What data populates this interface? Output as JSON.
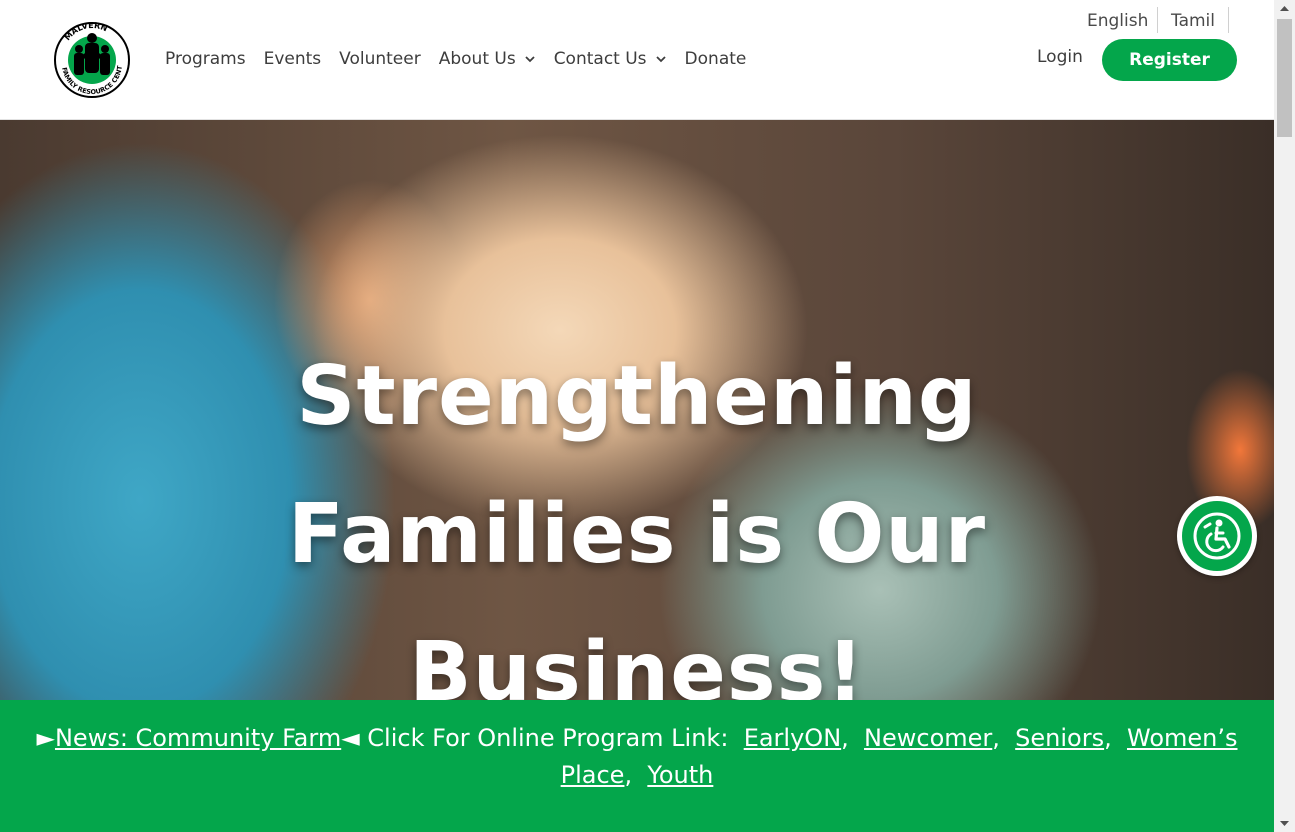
{
  "header": {
    "logo_text": "MALVERN FAMILY RESOURCE CENTRE",
    "nav": [
      {
        "label": "Programs"
      },
      {
        "label": "Events"
      },
      {
        "label": "Volunteer"
      },
      {
        "label": "About Us",
        "dropdown": true
      },
      {
        "label": "Contact Us",
        "dropdown": true
      },
      {
        "label": "Donate"
      }
    ],
    "languages": [
      "English",
      "Tamil"
    ],
    "login_label": "Login",
    "register_label": "Register"
  },
  "hero": {
    "title_line1": "Strengthening",
    "title_line2": "Families is Our",
    "title_line3": "Business!"
  },
  "banner": {
    "prefix_arrow": "►",
    "news_link": "News: Community Farm",
    "suffix_arrow": "◄",
    "text": " Click For Online Program Link: ",
    "links": [
      "EarlyON",
      "Newcomer",
      "Seniors",
      "Women’s Place",
      "Youth"
    ]
  },
  "colors": {
    "brand_green": "#04a64b",
    "nav_text": "#3d3d3d"
  },
  "icons": {
    "accessibility": "wheelchair-icon",
    "dropdown": "chevron-down-icon"
  }
}
